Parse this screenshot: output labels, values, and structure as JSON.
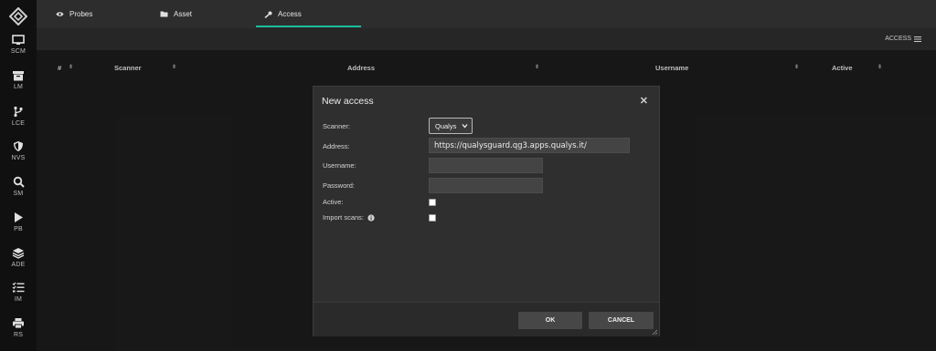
{
  "sidebar": {
    "items": [
      {
        "label": "SCM",
        "icon": "monitor-icon"
      },
      {
        "label": "LM",
        "icon": "archive-icon"
      },
      {
        "label": "LCE",
        "icon": "code-branch-icon"
      },
      {
        "label": "NVS",
        "icon": "shield-icon"
      },
      {
        "label": "SM",
        "icon": "search-icon"
      },
      {
        "label": "PB",
        "icon": "play-icon"
      },
      {
        "label": "ADE",
        "icon": "layers-icon"
      },
      {
        "label": "IM",
        "icon": "tasks-icon"
      },
      {
        "label": "RS",
        "icon": "printer-icon"
      }
    ]
  },
  "tabs": [
    {
      "label": "Probes",
      "icon": "eye-icon"
    },
    {
      "label": "Asset",
      "icon": "folder-icon"
    },
    {
      "label": "Access",
      "icon": "key-icon",
      "active": true
    }
  ],
  "subbar": {
    "access_label": "ACCESS"
  },
  "table": {
    "columns": [
      "#",
      "Scanner",
      "Address",
      "Username",
      "Active"
    ]
  },
  "modal": {
    "title": "New access",
    "close": "✕",
    "fields": {
      "scanner_label": "Scanner:",
      "scanner_value": "Qualys",
      "address_label": "Address:",
      "address_value": "https://qualysguard.qg3.apps.qualys.it/",
      "username_label": "Username:",
      "username_value": "",
      "password_label": "Password:",
      "password_value": "",
      "active_label": "Active:",
      "import_label": "Import scans:"
    },
    "ok_label": "OK",
    "cancel_label": "CANCEL"
  },
  "colors": {
    "accent": "#1abc9c",
    "background": "#1b1b1b",
    "sidebar": "#101010",
    "modal": "#2f2f2f"
  }
}
